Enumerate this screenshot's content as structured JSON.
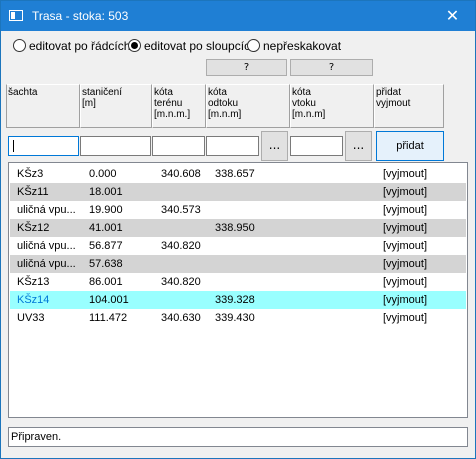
{
  "window": {
    "title": "Trasa - stoka: 503",
    "close_glyph": "✕"
  },
  "modes": [
    {
      "label": "editovat po řádcích",
      "selected": false
    },
    {
      "label": "editovat po sloupcích",
      "selected": true
    },
    {
      "label": "nepřeskakovat",
      "selected": false
    }
  ],
  "question_buttons": [
    "?",
    "?"
  ],
  "columns": [
    {
      "label": "šachta"
    },
    {
      "label": "staničení\n[m]"
    },
    {
      "label": "kóta\nterénu\n[m.n.m.]"
    },
    {
      "label": "kóta\nodtoku\n[m.n.m]"
    },
    {
      "label": "kóta\nvtoku\n[m.n.m]"
    },
    {
      "label": "přidat\nvyjmout"
    }
  ],
  "inputs": {
    "sachta": "",
    "staniceni": "",
    "kota_terenu": "",
    "kota_odtoku": "",
    "kota_vtoku": ""
  },
  "browse_label": "...",
  "add_label": "přidat",
  "rows": [
    {
      "sachta": "KŠz3",
      "staniceni": "0.000",
      "kota_terenu": "340.608",
      "kota_odtoku": "338.657",
      "action": "[vyjmout]",
      "style": "normal"
    },
    {
      "sachta": "KŠz11",
      "staniceni": "18.001",
      "kota_terenu": "",
      "kota_odtoku": "",
      "action": "[vyjmout]",
      "style": "alt"
    },
    {
      "sachta": "uličná vpu...",
      "staniceni": "19.900",
      "kota_terenu": "340.573",
      "kota_odtoku": "",
      "action": "[vyjmout]",
      "style": "normal"
    },
    {
      "sachta": "KŠz12",
      "staniceni": "41.001",
      "kota_terenu": "",
      "kota_odtoku": "338.950",
      "action": "[vyjmout]",
      "style": "alt"
    },
    {
      "sachta": "uličná vpu...",
      "staniceni": "56.877",
      "kota_terenu": "340.820",
      "kota_odtoku": "",
      "action": "[vyjmout]",
      "style": "normal"
    },
    {
      "sachta": "uličná vpu...",
      "staniceni": "57.638",
      "kota_terenu": "",
      "kota_odtoku": "",
      "action": "[vyjmout]",
      "style": "alt"
    },
    {
      "sachta": "KŠz13",
      "staniceni": "86.001",
      "kota_terenu": "340.820",
      "kota_odtoku": "",
      "action": "[vyjmout]",
      "style": "normal"
    },
    {
      "sachta": "KŠz14",
      "staniceni": "104.001",
      "kota_terenu": "",
      "kota_odtoku": "339.328",
      "action": "[vyjmout]",
      "style": "sel"
    },
    {
      "sachta": "UV33",
      "staniceni": "111.472",
      "kota_terenu": "340.630",
      "kota_odtoku": "339.430",
      "action": "[vyjmout]",
      "style": "normal"
    }
  ],
  "status": "Připraven.",
  "colors": {
    "titlebar": "#1f7fd4",
    "alt_row": "#d4d4d4",
    "selected_row": "#99ffff",
    "accent": "#0078d7"
  }
}
